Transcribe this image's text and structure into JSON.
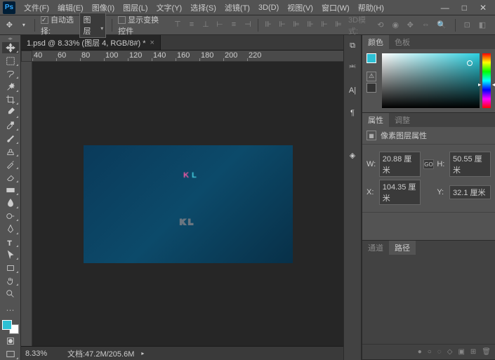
{
  "menubar": {
    "items": [
      "文件(F)",
      "编辑(E)",
      "图像(I)",
      "图层(L)",
      "文字(Y)",
      "选择(S)",
      "滤镜(T)",
      "3D(D)",
      "视图(V)",
      "窗口(W)",
      "帮助(H)"
    ]
  },
  "options": {
    "auto_select_label": "自动选择:",
    "auto_select_value": "图层",
    "show_transform_label": "显示变换控件",
    "threed_label": "3D模式:"
  },
  "doc_tab": {
    "title": "1.psd @ 8.33% (图层 4, RGB/8#) *"
  },
  "ruler_h": [
    "40",
    "60",
    "80",
    "100",
    "120",
    "140",
    "160",
    "180",
    "200",
    "220"
  ],
  "status": {
    "zoom": "8.33%",
    "docinfo": "文档:47.2M/205.6M"
  },
  "panels": {
    "color": {
      "tab1": "颜色",
      "tab2": "色板"
    },
    "properties": {
      "tab1": "属性",
      "tab2": "调整",
      "header": "像素图层属性",
      "w_label": "W:",
      "w_value": "20.88 厘米",
      "h_label": "H:",
      "h_value": "50.55 厘米",
      "x_label": "X:",
      "x_value": "104.35 厘米",
      "y_label": "Y:",
      "y_value": "32.1 厘米",
      "link": "GO"
    },
    "layers": {
      "tab1": "通道",
      "tab2": "路径"
    }
  },
  "swatch_colors": {
    "fg": "#2dc0d4",
    "bg": "#ffffff"
  },
  "art_text": "KL"
}
